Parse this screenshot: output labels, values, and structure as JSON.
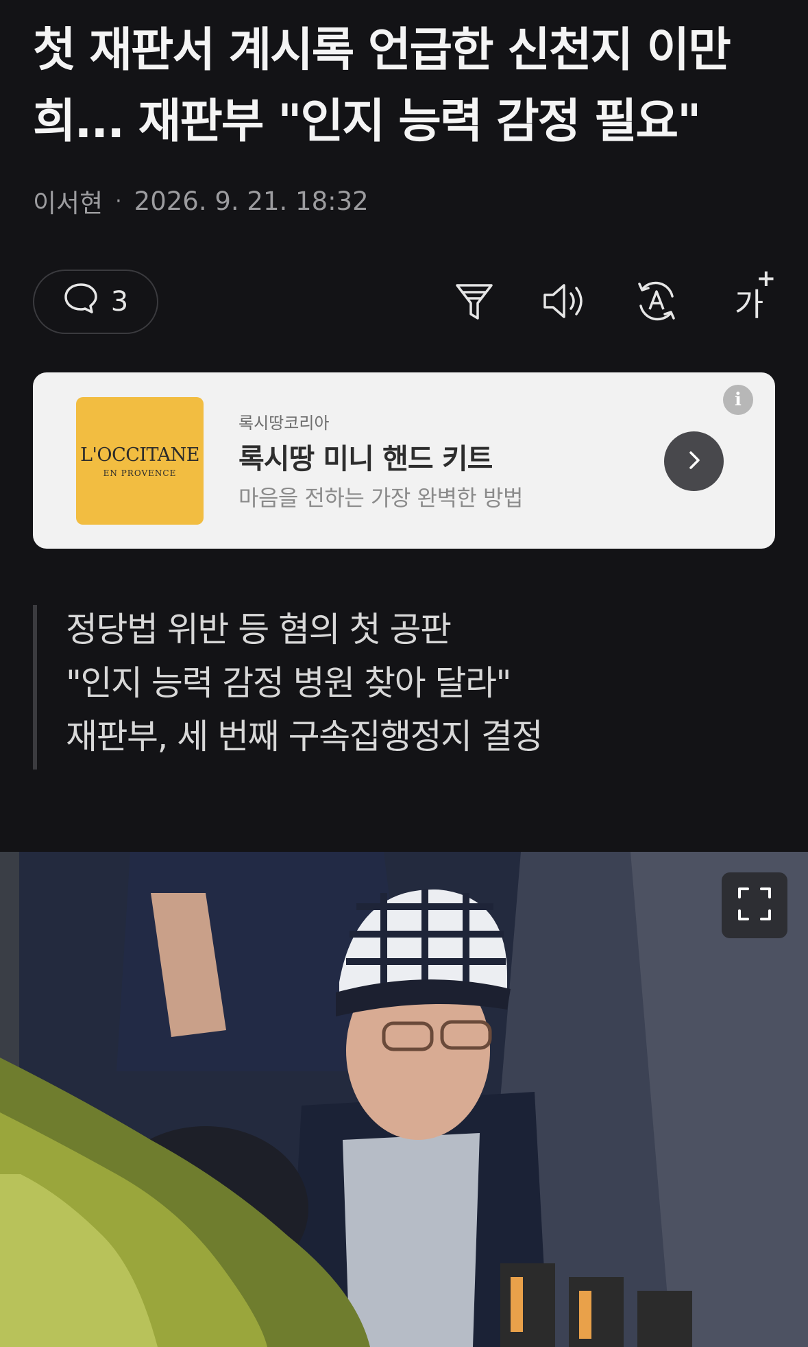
{
  "article": {
    "title": "첫 재판서 계시록 언급한 신천지 이만희... 재판부 \"인지 능력 감정 필요\"",
    "author": "이서현",
    "separator": "·",
    "datetime": "2026. 9. 21. 18:32"
  },
  "toolbar": {
    "comment_count": "3",
    "icons": [
      "comment-icon",
      "filter-icon",
      "speaker-icon",
      "translate-icon",
      "font-size-icon"
    ],
    "font_size_label": "가"
  },
  "ad": {
    "brand_logo_text": "L'OCCITANE",
    "brand_logo_sub": "EN PROVENCE",
    "advertiser": "록시땅코리아",
    "title": "록시땅 미니 핸드 키트",
    "description": "마음을 전하는 가장 완벽한 방법",
    "info_label": "i",
    "logo_color": "#f2bd41"
  },
  "summary": [
    "정당법 위반 등 혐의 첫 공판",
    "\"인지 능력 감정 병원 찾아 달라\"",
    "재판부, 세 번째 구속집행정지 결정"
  ],
  "colors": {
    "background": "#131316",
    "ad_background": "#f2f2f2"
  }
}
